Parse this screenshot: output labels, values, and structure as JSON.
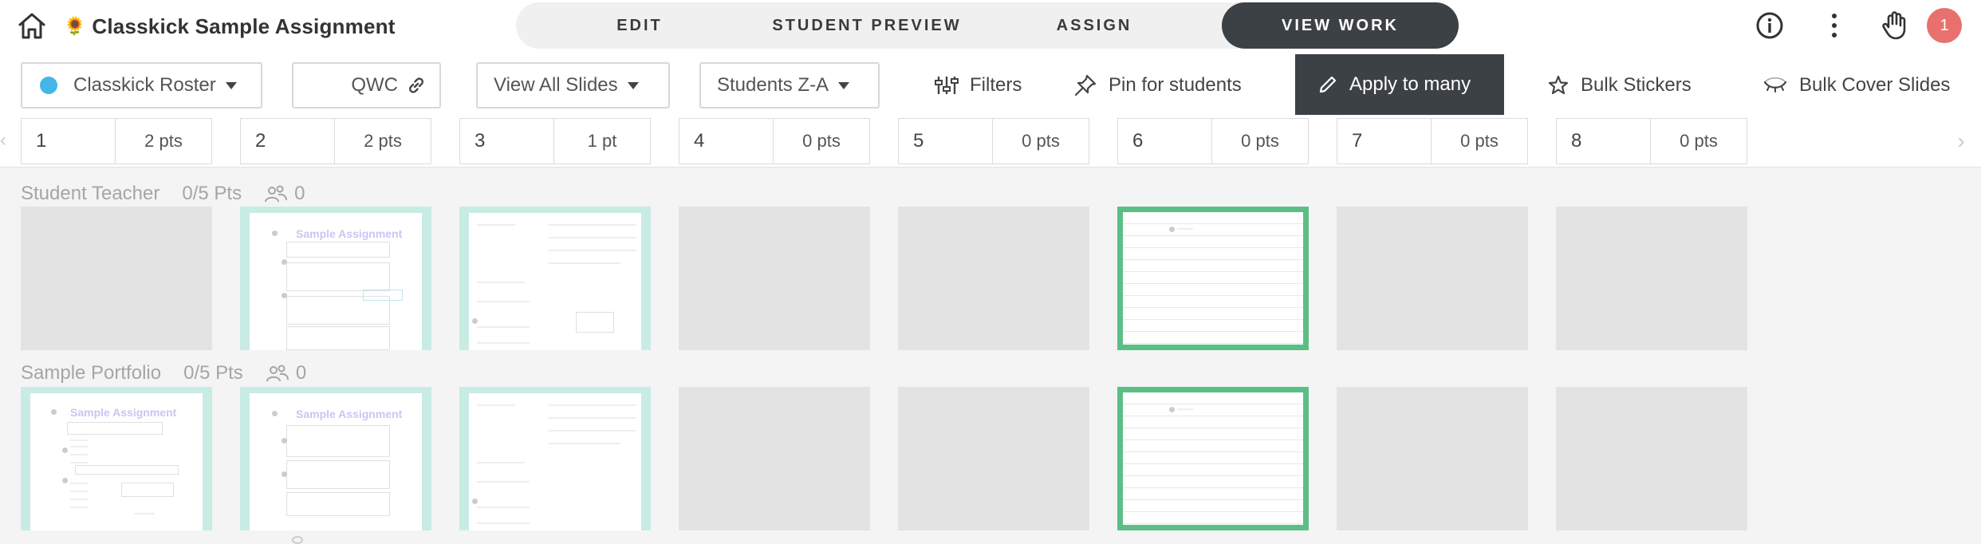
{
  "header": {
    "title": "Classkick Sample Assignment",
    "title_emoji": "🌻",
    "tabs": [
      {
        "label": "EDIT",
        "active": false
      },
      {
        "label": "STUDENT PREVIEW",
        "active": false
      },
      {
        "label": "ASSIGN",
        "active": false
      },
      {
        "label": "VIEW WORK",
        "active": true
      }
    ],
    "notification_count": "1",
    "icons": [
      "home-icon",
      "info-icon",
      "more-vertical-icon",
      "raised-hand-icon"
    ]
  },
  "toolbar": {
    "roster_label": "Classkick Roster",
    "roster_color": "#45b6e8",
    "code_label": "QWC",
    "slides_filter": "View All Slides",
    "sort_label": "Students Z-A",
    "filters_label": "Filters",
    "pin_label": "Pin for students",
    "apply_label": "Apply to many",
    "stickers_label": "Bulk Stickers",
    "cover_label": "Bulk Cover Slides"
  },
  "slides": [
    {
      "num": "1",
      "pts": "2 pts"
    },
    {
      "num": "2",
      "pts": "2 pts"
    },
    {
      "num": "3",
      "pts": "1 pt"
    },
    {
      "num": "4",
      "pts": "0 pts"
    },
    {
      "num": "5",
      "pts": "0 pts"
    },
    {
      "num": "6",
      "pts": "0 pts"
    },
    {
      "num": "7",
      "pts": "0 pts"
    },
    {
      "num": "8",
      "pts": "0 pts"
    }
  ],
  "students": [
    {
      "name": "Student Teacher",
      "score": "0/5 Pts",
      "helpers": "0"
    },
    {
      "name": "Sample Portfolio",
      "score": "0/5 Pts",
      "helpers": "0"
    }
  ],
  "thumb_text": {
    "sample_assignment": "Sample Assignment"
  },
  "colors": {
    "active_tab": "#3c4146",
    "badge": "#e8716d",
    "teal_border": "#c8ece3",
    "green_border": "#5bbf85"
  }
}
